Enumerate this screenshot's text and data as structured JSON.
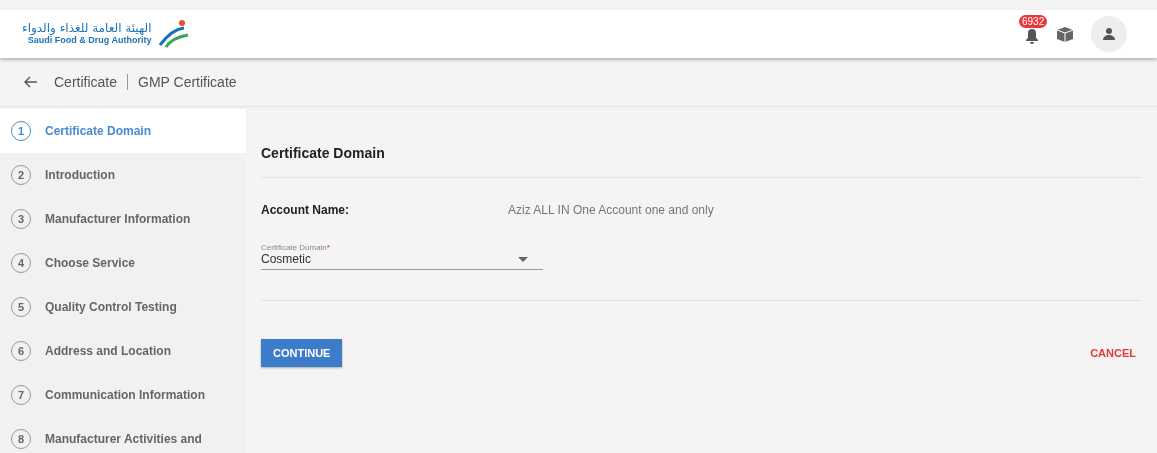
{
  "header": {
    "logo_arabic": "الهيئة العامة للغذاء والدواء",
    "logo_english": "Saudi Food & Drug Authority",
    "notification_count": "6932"
  },
  "breadcrumb": {
    "items": [
      "Certificate",
      "GMP Certificate"
    ]
  },
  "steps": [
    {
      "number": "1",
      "label": "Certificate Domain",
      "selected": true
    },
    {
      "number": "2",
      "label": "Introduction",
      "selected": false
    },
    {
      "number": "3",
      "label": "Manufacturer Information",
      "selected": false
    },
    {
      "number": "4",
      "label": "Choose Service",
      "selected": false
    },
    {
      "number": "5",
      "label": "Quality Control Testing",
      "selected": false
    },
    {
      "number": "6",
      "label": "Address and Location",
      "selected": false
    },
    {
      "number": "7",
      "label": "Communication Information",
      "selected": false
    },
    {
      "number": "8",
      "label": "Manufacturer Activities and",
      "selected": false
    }
  ],
  "form": {
    "title": "Certificate Domain",
    "account_label": "Account Name:",
    "account_value": "Aziz ALL IN One Account one and only",
    "domain_field": {
      "label": "Certificate Domain",
      "required_mark": "*",
      "value": "Cosmetic"
    },
    "continue_button": "CONTINUE",
    "cancel_button": "CANCEL"
  }
}
